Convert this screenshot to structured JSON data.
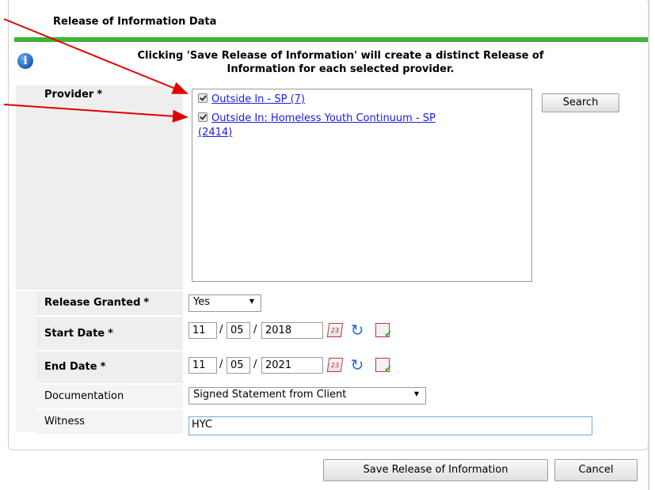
{
  "dialog": {
    "title": "Release of Information Data",
    "notice_line1": "Clicking 'Save Release of Information' will create a distinct Release of",
    "notice_line2": "Information for each selected provider."
  },
  "fields": {
    "provider_label": "Provider",
    "release_granted_label": "Release Granted",
    "start_date_label": "Start Date",
    "end_date_label": "End Date",
    "documentation_label": "Documentation",
    "witness_label": "Witness",
    "required_marker": "*"
  },
  "providers": [
    {
      "line1": "Outside In - SP (7)",
      "line2": "",
      "checked": true
    },
    {
      "line1": "Outside In: Homeless Youth Continuum - SP",
      "line2": "(2414)",
      "checked": true
    }
  ],
  "search_button": "Search",
  "release_granted": {
    "value": "Yes"
  },
  "start_date": {
    "month": "11",
    "day": "05",
    "year": "2018"
  },
  "end_date": {
    "month": "11",
    "day": "05",
    "year": "2021"
  },
  "documentation": {
    "value": "Signed Statement from Client"
  },
  "witness": {
    "value": "HYC"
  },
  "calendar_icon_text": "23",
  "buttons": {
    "save": "Save Release of Information",
    "cancel": "Cancel"
  },
  "colors": {
    "accent_green": "#3fb33a",
    "arrow_red": "#e00000",
    "link_blue": "#1a1aee"
  }
}
